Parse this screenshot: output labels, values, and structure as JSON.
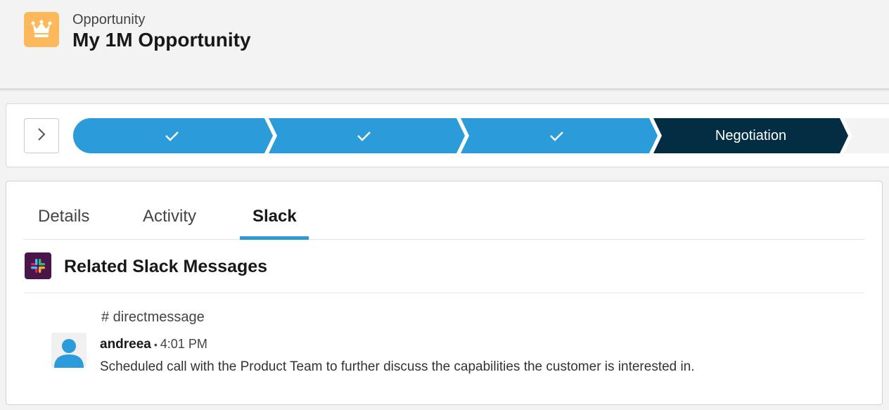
{
  "header": {
    "object_type": "Opportunity",
    "record_name": "My 1M Opportunity",
    "icon": "crown-icon",
    "icon_color": "#fcb95b"
  },
  "path": {
    "toggle_icon": "chevron-right-icon",
    "stages": [
      {
        "status": "complete",
        "icon": "check-icon",
        "label": ""
      },
      {
        "status": "complete",
        "icon": "check-icon",
        "label": ""
      },
      {
        "status": "complete",
        "icon": "check-icon",
        "label": ""
      },
      {
        "status": "current",
        "label": "Negotiation"
      },
      {
        "status": "incomplete",
        "label": ""
      }
    ],
    "colors": {
      "complete": "#2b9bd9",
      "current": "#032d42",
      "incomplete": "#f3f3f3"
    }
  },
  "tabs": [
    {
      "label": "Details",
      "active": false
    },
    {
      "label": "Activity",
      "active": false
    },
    {
      "label": "Slack",
      "active": true
    }
  ],
  "slack": {
    "section_title": "Related Slack Messages",
    "logo": "slack-logo-icon",
    "channel": "# directmessage",
    "message": {
      "author": "andreea",
      "separator": "•",
      "time": "4:01 PM",
      "text": "Scheduled call with the Product Team to further discuss the capabilities the customer is interested in.",
      "avatar": "user-avatar-icon"
    }
  }
}
